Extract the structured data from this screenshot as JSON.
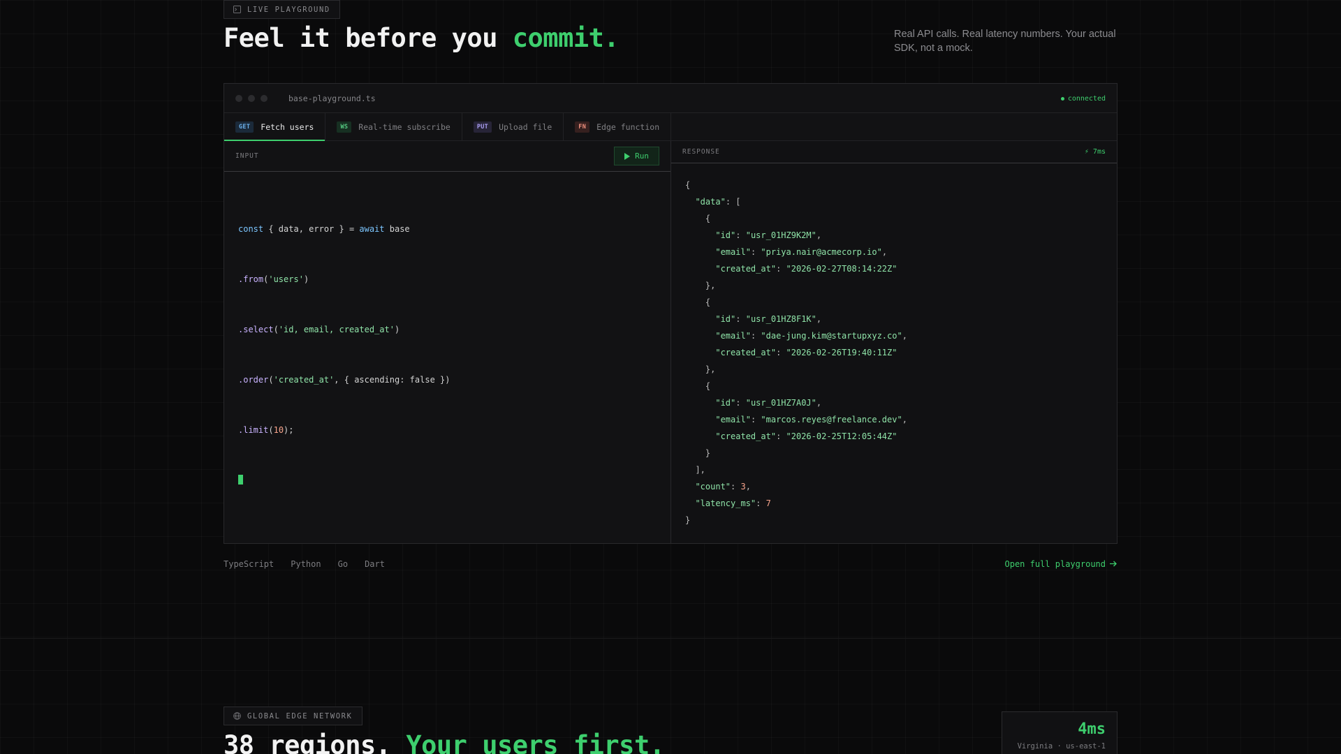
{
  "playground_section": {
    "badge": "LIVE PLAYGROUND",
    "badge_icon": "terminal-icon",
    "headline_main": "Feel it before you ",
    "headline_accent": "commit.",
    "subcopy": "Real API calls. Real latency numbers. Your actual SDK, not a mock."
  },
  "window": {
    "filename": "base-playground.ts",
    "status": "connected",
    "tabs": [
      {
        "method": "GET",
        "label": "Fetch users",
        "active": true
      },
      {
        "method": "WS",
        "label": "Real-time subscribe",
        "active": false
      },
      {
        "method": "PUT",
        "label": "Upload file",
        "active": false
      },
      {
        "method": "FN",
        "label": "Edge function",
        "active": false
      }
    ],
    "input_label": "INPUT",
    "run_label": "Run",
    "response_label": "RESPONSE",
    "latency": "⚡ 7ms"
  },
  "code": {
    "l1_kw": "const",
    "l1_mid": " { data, error } = ",
    "l1_kw2": "await",
    "l1_end": " base",
    "l2_fn": ".from",
    "l2_arg": "'users'",
    "l3_fn": ".select",
    "l3_arg": "'id, email, created_at'",
    "l4_fn": ".order",
    "l4_arg": "'created_at'",
    "l4_rest": ", { ascending: false })",
    "l5_fn": ".limit",
    "l5_arg": "10"
  },
  "response": {
    "records": [
      {
        "id": "usr_01HZ9K2M",
        "email": "priya.nair@acmecorp.io",
        "created_at": "2026-02-27T08:14:22Z"
      },
      {
        "id": "usr_01HZ8F1K",
        "email": "dae-jung.kim@startupxyz.co",
        "created_at": "2026-02-26T19:40:11Z"
      },
      {
        "id": "usr_01HZ7A0J",
        "email": "marcos.reyes@freelance.dev",
        "created_at": "2026-02-25T12:05:44Z"
      }
    ],
    "count": "3",
    "latency_ms": "7"
  },
  "languages": [
    "TypeScript",
    "Python",
    "Go",
    "Dart"
  ],
  "open_link": "Open full playground",
  "network_section": {
    "badge": "GLOBAL EDGE NETWORK",
    "badge_icon": "globe-icon",
    "headline_main": "38 regions. ",
    "headline_accent": "Your users first.",
    "metric_value": "4ms",
    "metric_label": "Virginia · us-east-1"
  },
  "colors": {
    "accent": "#3ecf6e",
    "background": "#0a0a0b",
    "panel": "#121214"
  }
}
